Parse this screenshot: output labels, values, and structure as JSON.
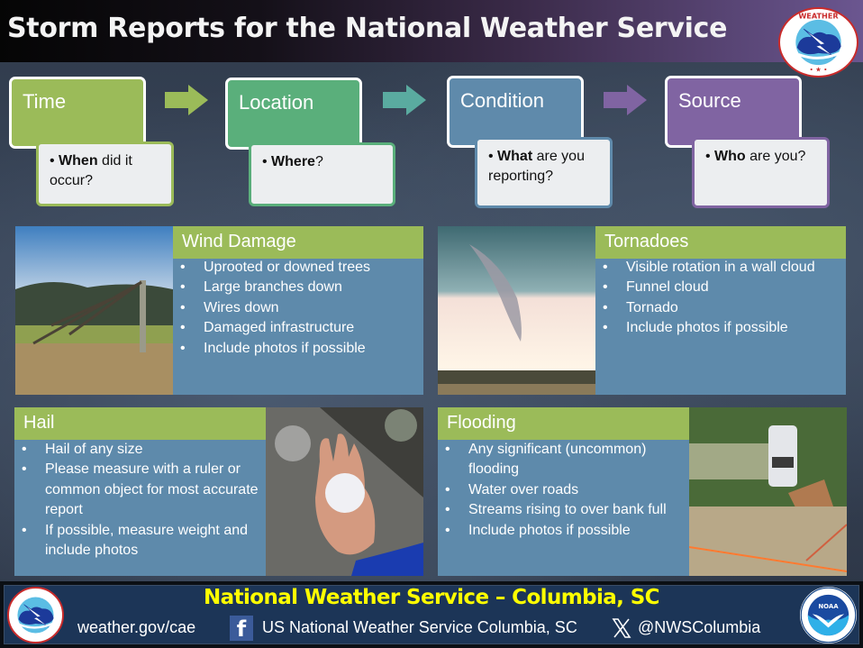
{
  "header": {
    "title": "Storm Reports for the National Weather Service",
    "logo": "nws-logo"
  },
  "flow": [
    {
      "label": "Time",
      "color": "#9bbb59",
      "bullet_bold": "When",
      "bullet_rest": " did it occur?"
    },
    {
      "label": "Location",
      "color": "#5aaf7b",
      "bullet_bold": "Where",
      "bullet_rest": "?"
    },
    {
      "label": "Condition",
      "color": "#5f8aab",
      "bullet_bold": "What",
      "bullet_rest": " are you reporting?"
    },
    {
      "label": "Source",
      "color": "#8064a2",
      "bullet_bold": "Who",
      "bullet_rest": " are you?"
    }
  ],
  "arrow_colors": [
    "#9bbb59",
    "#5aaba0",
    "#8064a2"
  ],
  "cards": {
    "wind": {
      "title": "Wind Damage",
      "photo": "fallen-tree-photo",
      "items": [
        "Uprooted or downed trees",
        "Large branches down",
        "Wires down",
        "Damaged infrastructure",
        "Include photos if possible"
      ]
    },
    "tornado": {
      "title": "Tornadoes",
      "photo": "tornado-funnel-photo",
      "items": [
        "Visible rotation in a wall cloud",
        "Funnel cloud",
        "Tornado",
        "Include photos if possible"
      ]
    },
    "hail": {
      "title": "Hail",
      "photo": "hail-in-hand-photo",
      "items": [
        "Hail of any size",
        "Please measure with a ruler or common object for most accurate report",
        "If possible, measure weight and include photos"
      ]
    },
    "flooding": {
      "title": "Flooding",
      "photo": "flooded-car-photo",
      "items": [
        "Any significant (uncommon) flooding",
        "Water over roads",
        "Streams rising to over bank full",
        "Include photos if possible"
      ]
    }
  },
  "footer": {
    "title": "National Weather Service – Columbia, SC",
    "website": "weather.gov/cae",
    "facebook_icon": "f",
    "facebook": "US National Weather Service Columbia, SC",
    "twitter": "@NWSColumbia",
    "left_logo": "nws-logo",
    "right_logo": "noaa-logo"
  },
  "colors": {
    "green_accent": "#9bbb59",
    "card_blue": "#5e8aab",
    "footer_bg": "#1c3557",
    "footer_title": "#ffff00"
  }
}
